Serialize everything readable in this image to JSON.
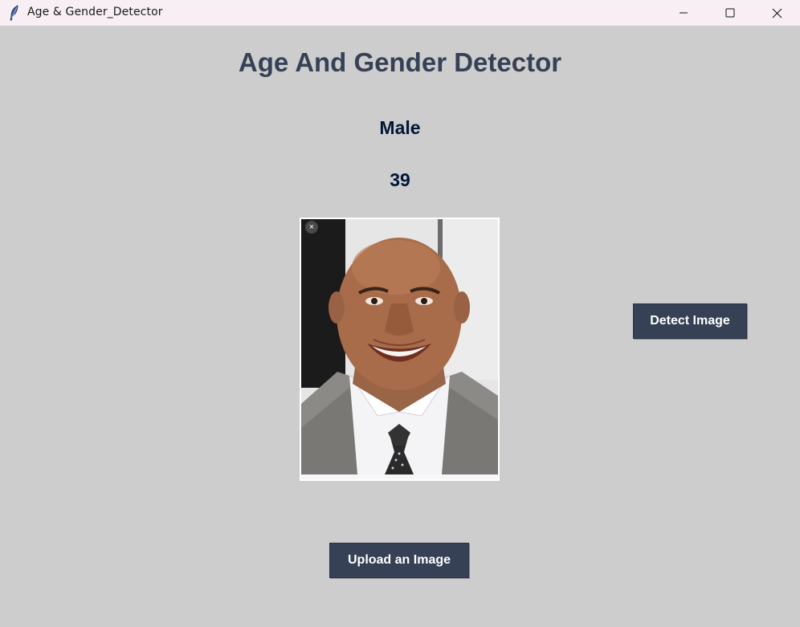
{
  "window": {
    "title": "Age & Gender_Detector",
    "icon": "feather-icon",
    "controls": [
      "minimize-icon",
      "maximize-icon",
      "close-icon"
    ]
  },
  "main": {
    "heading": "Age And Gender Detector",
    "gender_result": "Male",
    "age_result": "39",
    "photo_close_glyph": "×",
    "detect_button_label": "Detect Image",
    "upload_button_label": "Upload an Image"
  },
  "colors": {
    "background": "#cdcdcd",
    "titlebar": "#f7eff3",
    "heading": "#364156",
    "result_text": "#011638",
    "button_bg": "#364156",
    "button_text": "#ffffff"
  }
}
